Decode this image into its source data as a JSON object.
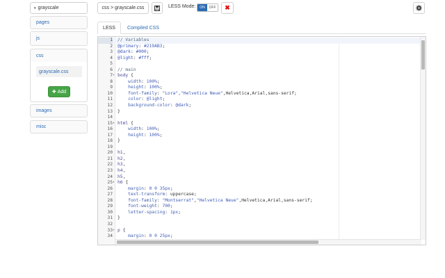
{
  "theme_select": {
    "label": "grayscale"
  },
  "sidebar": {
    "folders": [
      {
        "label": "pages"
      },
      {
        "label": "js"
      },
      {
        "label": "css"
      },
      {
        "label": "images"
      },
      {
        "label": "misc"
      }
    ],
    "css_files": [
      "grayscale.css"
    ],
    "add_label": "Add"
  },
  "toolbar": {
    "breadcrumb": "css > grayscale.css",
    "less_mode_label": "LESS Mode:",
    "toggle_on": "ON",
    "toggle_off": "OFF",
    "close_glyph": "✖"
  },
  "tabs": [
    {
      "label": "LESS",
      "active": true
    },
    {
      "label": "Compiled CSS",
      "active": false
    }
  ],
  "editor": {
    "active_line": 1,
    "lines": [
      {
        "n": 1,
        "fold": false,
        "parts": [
          [
            "cm",
            "// Variables"
          ]
        ]
      },
      {
        "n": 2,
        "fold": false,
        "parts": [
          [
            "var",
            "@primary"
          ],
          [
            "plain",
            ": "
          ],
          [
            "num",
            "#219AB3"
          ],
          [
            "plain",
            ";"
          ]
        ]
      },
      {
        "n": 3,
        "fold": false,
        "parts": [
          [
            "var",
            "@dark"
          ],
          [
            "plain",
            ": "
          ],
          [
            "num",
            "#000"
          ],
          [
            "plain",
            ";"
          ]
        ]
      },
      {
        "n": 4,
        "fold": false,
        "parts": [
          [
            "var",
            "@light"
          ],
          [
            "plain",
            ": "
          ],
          [
            "num",
            "#fff"
          ],
          [
            "plain",
            ";"
          ]
        ]
      },
      {
        "n": 5,
        "fold": false,
        "parts": []
      },
      {
        "n": 6,
        "fold": false,
        "parts": [
          [
            "cm",
            "// main"
          ]
        ]
      },
      {
        "n": 7,
        "fold": true,
        "parts": [
          [
            "tag",
            "body"
          ],
          [
            "plain",
            " {"
          ]
        ]
      },
      {
        "n": 8,
        "fold": false,
        "parts": [
          [
            "plain",
            "    "
          ],
          [
            "prop",
            "width"
          ],
          [
            "plain",
            ": "
          ],
          [
            "num",
            "100%"
          ],
          [
            "plain",
            ";"
          ]
        ]
      },
      {
        "n": 9,
        "fold": false,
        "parts": [
          [
            "plain",
            "    "
          ],
          [
            "prop",
            "height"
          ],
          [
            "plain",
            ": "
          ],
          [
            "num",
            "100%"
          ],
          [
            "plain",
            ";"
          ]
        ]
      },
      {
        "n": 10,
        "fold": false,
        "parts": [
          [
            "plain",
            "    "
          ],
          [
            "prop",
            "font-family"
          ],
          [
            "plain",
            ": "
          ],
          [
            "str",
            "\"Lora\""
          ],
          [
            "plain",
            ","
          ],
          [
            "str",
            "\"Helvetica Neue\""
          ],
          [
            "plain",
            ",Helvetica,Arial,sans-serif;"
          ]
        ]
      },
      {
        "n": 11,
        "fold": false,
        "parts": [
          [
            "plain",
            "    "
          ],
          [
            "prop",
            "color"
          ],
          [
            "plain",
            ": "
          ],
          [
            "var",
            "@light"
          ],
          [
            "plain",
            ";"
          ]
        ]
      },
      {
        "n": 12,
        "fold": false,
        "parts": [
          [
            "plain",
            "    "
          ],
          [
            "prop",
            "background-color"
          ],
          [
            "plain",
            ": "
          ],
          [
            "var",
            "@dark"
          ],
          [
            "plain",
            ";"
          ]
        ]
      },
      {
        "n": 13,
        "fold": false,
        "parts": [
          [
            "plain",
            "}"
          ]
        ]
      },
      {
        "n": 14,
        "fold": false,
        "parts": []
      },
      {
        "n": 15,
        "fold": true,
        "parts": [
          [
            "tag",
            "html"
          ],
          [
            "plain",
            " {"
          ]
        ]
      },
      {
        "n": 16,
        "fold": false,
        "parts": [
          [
            "plain",
            "    "
          ],
          [
            "prop",
            "width"
          ],
          [
            "plain",
            ": "
          ],
          [
            "num",
            "100%"
          ],
          [
            "plain",
            ";"
          ]
        ]
      },
      {
        "n": 17,
        "fold": false,
        "parts": [
          [
            "plain",
            "    "
          ],
          [
            "prop",
            "height"
          ],
          [
            "plain",
            ": "
          ],
          [
            "num",
            "100%"
          ],
          [
            "plain",
            ";"
          ]
        ]
      },
      {
        "n": 18,
        "fold": false,
        "parts": [
          [
            "plain",
            "}"
          ]
        ]
      },
      {
        "n": 19,
        "fold": false,
        "parts": []
      },
      {
        "n": 20,
        "fold": false,
        "parts": [
          [
            "tag",
            "h1"
          ],
          [
            "plain",
            ","
          ]
        ]
      },
      {
        "n": 21,
        "fold": false,
        "parts": [
          [
            "tag",
            "h2"
          ],
          [
            "plain",
            ","
          ]
        ]
      },
      {
        "n": 22,
        "fold": false,
        "parts": [
          [
            "tag",
            "h3"
          ],
          [
            "plain",
            ","
          ]
        ]
      },
      {
        "n": 23,
        "fold": false,
        "parts": [
          [
            "tag",
            "h4"
          ],
          [
            "plain",
            ","
          ]
        ]
      },
      {
        "n": 24,
        "fold": false,
        "parts": [
          [
            "tag",
            "h5"
          ],
          [
            "plain",
            ","
          ]
        ]
      },
      {
        "n": 25,
        "fold": true,
        "parts": [
          [
            "tag",
            "h6"
          ],
          [
            "plain",
            " {"
          ]
        ]
      },
      {
        "n": 26,
        "fold": false,
        "parts": [
          [
            "plain",
            "    "
          ],
          [
            "prop",
            "margin"
          ],
          [
            "plain",
            ": "
          ],
          [
            "num",
            "0 0 35px"
          ],
          [
            "plain",
            ";"
          ]
        ]
      },
      {
        "n": 27,
        "fold": false,
        "parts": [
          [
            "plain",
            "    "
          ],
          [
            "prop",
            "text-transform"
          ],
          [
            "plain",
            ": uppercase;"
          ]
        ]
      },
      {
        "n": 28,
        "fold": false,
        "parts": [
          [
            "plain",
            "    "
          ],
          [
            "prop",
            "font-family"
          ],
          [
            "plain",
            ": "
          ],
          [
            "str",
            "\"Montserrat\""
          ],
          [
            "plain",
            ","
          ],
          [
            "str",
            "\"Helvetica Neue\""
          ],
          [
            "plain",
            ",Helvetica,Arial,sans-serif;"
          ]
        ]
      },
      {
        "n": 29,
        "fold": false,
        "parts": [
          [
            "plain",
            "    "
          ],
          [
            "prop",
            "font-weight"
          ],
          [
            "plain",
            ": "
          ],
          [
            "num",
            "700"
          ],
          [
            "plain",
            ";"
          ]
        ]
      },
      {
        "n": 30,
        "fold": false,
        "parts": [
          [
            "plain",
            "    "
          ],
          [
            "prop",
            "letter-spacing"
          ],
          [
            "plain",
            ": "
          ],
          [
            "num",
            "1px"
          ],
          [
            "plain",
            ";"
          ]
        ]
      },
      {
        "n": 31,
        "fold": false,
        "parts": [
          [
            "plain",
            "}"
          ]
        ]
      },
      {
        "n": 32,
        "fold": false,
        "parts": []
      },
      {
        "n": 33,
        "fold": true,
        "parts": [
          [
            "tag",
            "p"
          ],
          [
            "plain",
            " {"
          ]
        ]
      },
      {
        "n": 34,
        "fold": false,
        "parts": [
          [
            "plain",
            "    "
          ],
          [
            "prop",
            "margin"
          ],
          [
            "plain",
            ": "
          ],
          [
            "num",
            "0 0 25px"
          ],
          [
            "plain",
            ";"
          ]
        ]
      }
    ]
  },
  "colors": {
    "link": "#2a6bb3",
    "add_button": "#46a546",
    "toggle_on": "#2a6bb3",
    "close_icon": "#dd1111"
  }
}
